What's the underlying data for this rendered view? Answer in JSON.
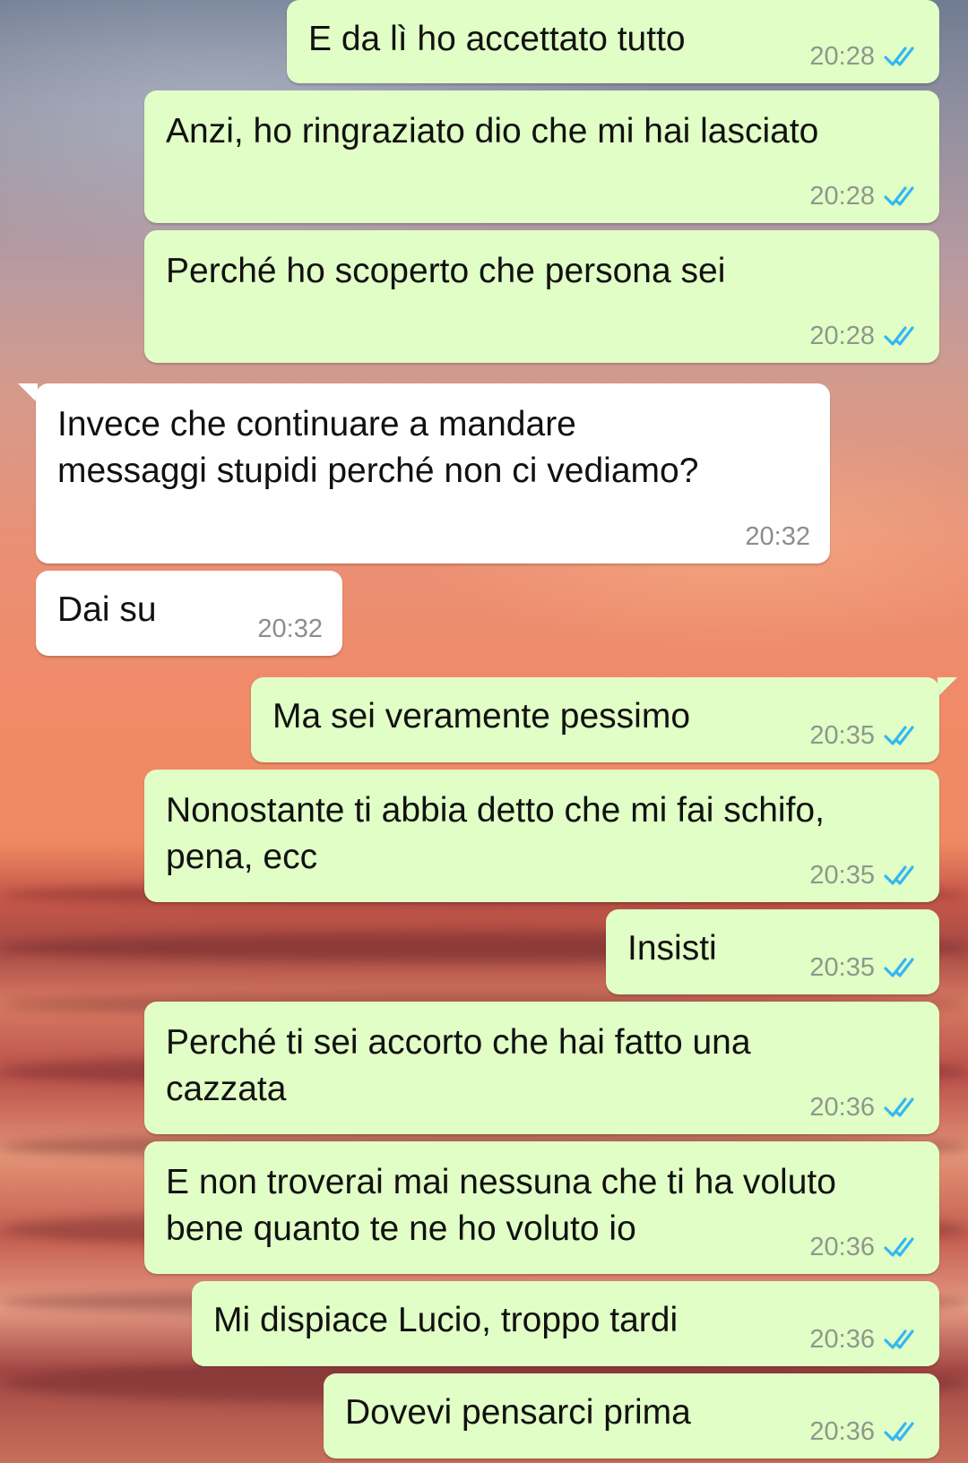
{
  "conversation": {
    "tick_color": "#34b7f1",
    "outgoing_bubble_color": "#e1fec6",
    "incoming_bubble_color": "#ffffff",
    "messages": [
      {
        "direction": "outgoing",
        "text": "E da lì ho accettato tutto",
        "time": "20:28",
        "status": "read-double-check-icon"
      },
      {
        "direction": "outgoing",
        "text": "Anzi, ho ringraziato dio che mi hai lasciato",
        "time": "20:28",
        "status": "read-double-check-icon"
      },
      {
        "direction": "outgoing",
        "text": "Perché ho scoperto che persona sei",
        "time": "20:28",
        "status": "read-double-check-icon"
      },
      {
        "direction": "incoming",
        "text": "Invece che continuare a mandare\nmessaggi stupidi perché non ci vediamo?",
        "time": "20:32"
      },
      {
        "direction": "incoming",
        "text": "Dai su",
        "time": "20:32"
      },
      {
        "direction": "outgoing",
        "text": "Ma sei veramente pessimo",
        "time": "20:35",
        "status": "read-double-check-icon"
      },
      {
        "direction": "outgoing",
        "text": "Nonostante ti abbia detto che mi fai schifo,\npena, ecc",
        "time": "20:35",
        "status": "read-double-check-icon"
      },
      {
        "direction": "outgoing",
        "text": "Insisti",
        "time": "20:35",
        "status": "read-double-check-icon"
      },
      {
        "direction": "outgoing",
        "text": "Perché ti sei accorto che hai fatto una\ncazzata",
        "time": "20:36",
        "status": "read-double-check-icon"
      },
      {
        "direction": "outgoing",
        "text": "E non troverai mai nessuna che ti ha voluto\nbene quanto te ne ho voluto io",
        "time": "20:36",
        "status": "read-double-check-icon"
      },
      {
        "direction": "outgoing",
        "text": "Mi dispiace Lucio, troppo tardi",
        "time": "20:36",
        "status": "read-double-check-icon"
      },
      {
        "direction": "outgoing",
        "text": "Dovevi pensarci prima",
        "time": "20:36",
        "status": "read-double-check-icon"
      }
    ]
  }
}
